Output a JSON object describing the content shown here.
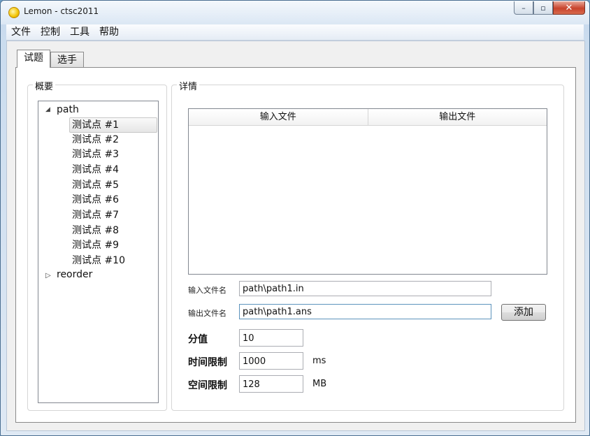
{
  "window": {
    "title": "Lemon - ctsc2011"
  },
  "caption": {
    "min": "–",
    "max": "▫",
    "close": "✕"
  },
  "menu": [
    "文件",
    "控制",
    "工具",
    "帮助"
  ],
  "tabs": [
    "试题",
    "选手"
  ],
  "overview": {
    "title": "概要",
    "tasks": [
      {
        "name": "path",
        "expanded": true,
        "tests": [
          "测试点 #1",
          "测试点 #2",
          "测试点 #3",
          "测试点 #4",
          "测试点 #5",
          "测试点 #6",
          "测试点 #7",
          "测试点 #8",
          "测试点 #9",
          "测试点 #10"
        ]
      },
      {
        "name": "reorder",
        "expanded": false
      }
    ]
  },
  "details": {
    "title": "详情",
    "table_headers": [
      "输入文件",
      "输出文件"
    ],
    "input_file_label": "输入文件名",
    "input_file_value": "path\\path1.in",
    "output_file_label": "输出文件名",
    "output_file_value": "path\\path1.ans",
    "add_button": "添加",
    "score_label": "分值",
    "score_value": "10",
    "time_label": "时间限制",
    "time_value": "1000",
    "time_unit": "ms",
    "memory_label": "空间限制",
    "memory_value": "128",
    "memory_unit": "MB"
  }
}
